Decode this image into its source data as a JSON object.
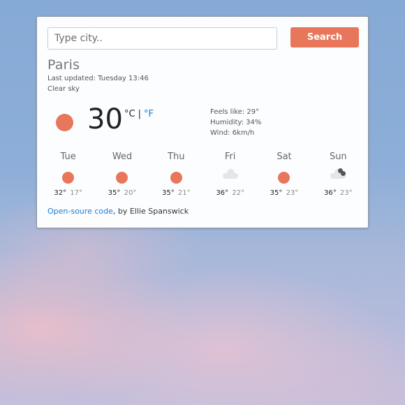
{
  "search": {
    "placeholder": "Type city..",
    "value": "",
    "button_label": "Search"
  },
  "current": {
    "city": "Paris",
    "last_updated": "Last updated: Tuesday 13:46",
    "description": "Clear sky",
    "icon": "sun-icon",
    "temperature": "30",
    "unit_c": "°C",
    "unit_separator": "|",
    "unit_f": "°F",
    "feels_like": "Feels like: 29°",
    "humidity": "Humidity: 34%",
    "wind": "Wind: 6km/h"
  },
  "forecast": [
    {
      "day": "Tue",
      "icon": "sun-icon",
      "max": "32°",
      "min": "17°"
    },
    {
      "day": "Wed",
      "icon": "sun-icon",
      "max": "35°",
      "min": "20°"
    },
    {
      "day": "Thu",
      "icon": "sun-icon",
      "max": "35°",
      "min": "21°"
    },
    {
      "day": "Fri",
      "icon": "cloud-icon",
      "max": "36°",
      "min": "22°"
    },
    {
      "day": "Sat",
      "icon": "sun-icon",
      "max": "35°",
      "min": "23°"
    },
    {
      "day": "Sun",
      "icon": "cloud-rain-icon",
      "max": "36°",
      "min": "23°"
    }
  ],
  "footer": {
    "link_text": "Open-soure code",
    "by_text": ", by Ellie Spanswick"
  },
  "colors": {
    "accent": "#e8765a",
    "link": "#1b7bd0"
  }
}
